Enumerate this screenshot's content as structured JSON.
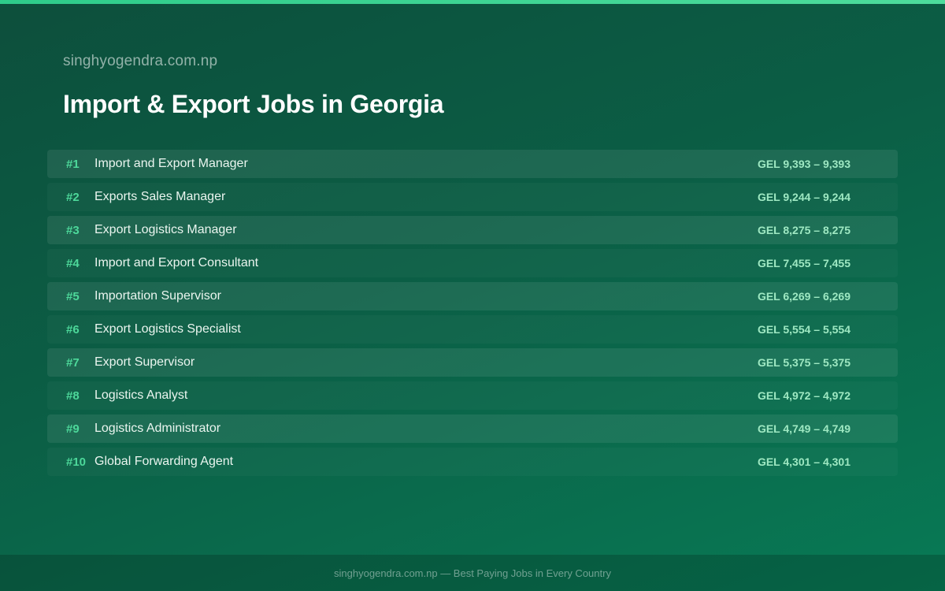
{
  "header": {
    "site_label": "singhyogendra.com.np",
    "title": "Import & Export Jobs in Georgia"
  },
  "jobs": [
    {
      "rank": "#1",
      "title": "Import and Export Manager",
      "salary": "GEL 9,393 – 9,393"
    },
    {
      "rank": "#2",
      "title": "Exports Sales Manager",
      "salary": "GEL 9,244 – 9,244"
    },
    {
      "rank": "#3",
      "title": "Export Logistics Manager",
      "salary": "GEL 8,275 – 8,275"
    },
    {
      "rank": "#4",
      "title": "Import and Export Consultant",
      "salary": "GEL 7,455 – 7,455"
    },
    {
      "rank": "#5",
      "title": "Importation Supervisor",
      "salary": "GEL 6,269 – 6,269"
    },
    {
      "rank": "#6",
      "title": "Export Logistics Specialist",
      "salary": "GEL 5,554 – 5,554"
    },
    {
      "rank": "#7",
      "title": "Export Supervisor",
      "salary": "GEL 5,375 – 5,375"
    },
    {
      "rank": "#8",
      "title": "Logistics Analyst",
      "salary": "GEL 4,972 – 4,972"
    },
    {
      "rank": "#9",
      "title": "Logistics Administrator",
      "salary": "GEL 4,749 – 4,749"
    },
    {
      "rank": "#10",
      "title": "Global Forwarding Agent",
      "salary": "GEL 4,301 – 4,301"
    }
  ],
  "footer": {
    "text": "singhyogendra.com.np — Best Paying Jobs in Every Country"
  },
  "colors": {
    "accent": "#4dd89a",
    "salary": "#9ee8c2",
    "background_start": "#0d4f3c",
    "background_end": "#087a55"
  }
}
